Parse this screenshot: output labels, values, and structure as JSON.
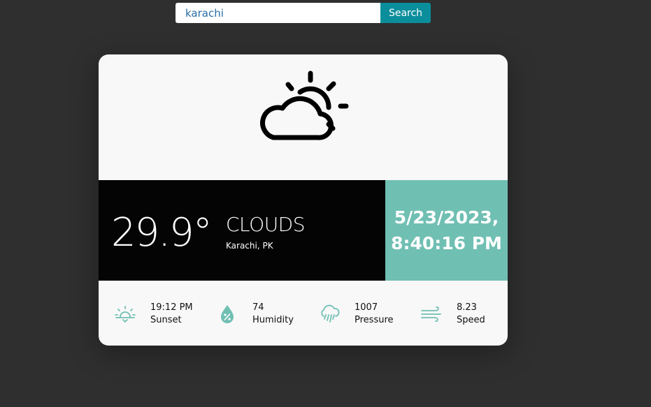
{
  "search": {
    "value": "karachi",
    "button_label": "Search"
  },
  "weather": {
    "icon": "cloud-sun-icon",
    "temperature": "29.9°",
    "condition": "CLOUDS",
    "location": "Karachi, PK",
    "date": "5/23/2023,",
    "time": "8:40:16 PM"
  },
  "stats": [
    {
      "icon": "sunset-icon",
      "value": "19:12 PM",
      "label": "Sunset"
    },
    {
      "icon": "humidity-drop-icon",
      "value": "74",
      "label": "Humidity"
    },
    {
      "icon": "rain-cloud-icon",
      "value": "1007",
      "label": "Pressure"
    },
    {
      "icon": "wind-icon",
      "value": "8.23",
      "label": "Speed"
    }
  ],
  "colors": {
    "background": "#2f2f2f",
    "accent": "#70bfb3",
    "search_button": "#0b8e9c",
    "temp_panel": "#050404",
    "card": "#f8f8f8"
  }
}
